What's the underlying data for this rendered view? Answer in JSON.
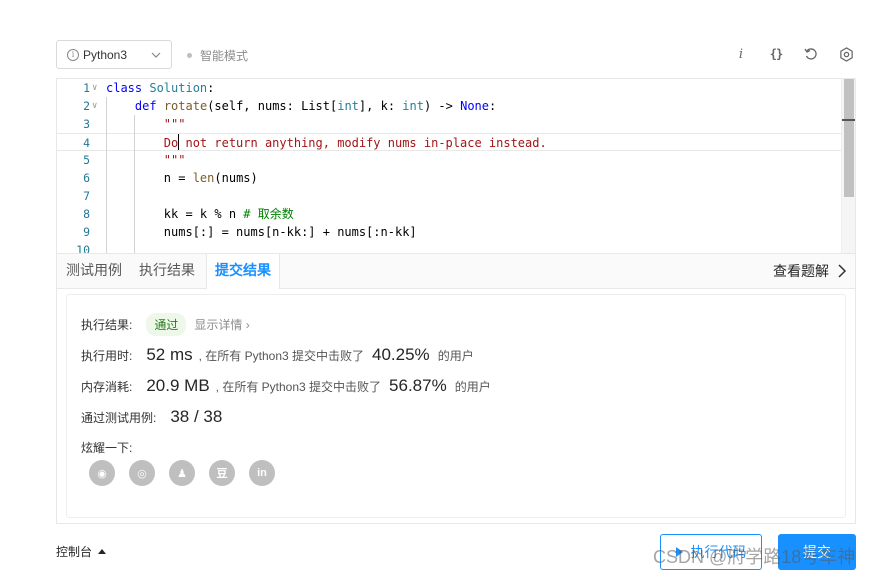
{
  "toolbar": {
    "language": "Python3",
    "smart_mode": "智能模式",
    "icons": [
      "info-icon",
      "braces-icon",
      "reset-icon",
      "settings-icon"
    ]
  },
  "editor": {
    "lines": [
      {
        "n": "1",
        "fold": "∨",
        "tokens": [
          [
            "kw",
            "class"
          ],
          [
            "",
            " "
          ],
          [
            "cls",
            "Solution"
          ],
          [
            "",
            ":"
          ]
        ]
      },
      {
        "n": "2",
        "fold": "∨",
        "tokens": [
          [
            "",
            "    "
          ],
          [
            "kw",
            "def"
          ],
          [
            "",
            " "
          ],
          [
            "fn",
            "rotate"
          ],
          [
            "",
            "(self, nums: List["
          ],
          [
            "bi",
            "int"
          ],
          [
            "",
            "], k: "
          ],
          [
            "bi",
            "int"
          ],
          [
            "",
            ") -> "
          ],
          [
            "kw",
            "None"
          ],
          [
            "",
            ":"
          ]
        ]
      },
      {
        "n": "3",
        "fold": "",
        "tokens": [
          [
            "",
            "        "
          ],
          [
            "str",
            "\"\"\""
          ]
        ]
      },
      {
        "n": "4",
        "fold": "",
        "tokens": [
          [
            "",
            "        "
          ],
          [
            "str",
            "Do not return anything, modify nums in-place instead."
          ]
        ]
      },
      {
        "n": "5",
        "fold": "",
        "tokens": [
          [
            "",
            "        "
          ],
          [
            "str",
            "\"\"\""
          ]
        ]
      },
      {
        "n": "6",
        "fold": "",
        "tokens": [
          [
            "",
            "        n = "
          ],
          [
            "fn",
            "len"
          ],
          [
            "",
            "(nums)"
          ]
        ]
      },
      {
        "n": "7",
        "fold": "",
        "tokens": [
          [
            "",
            ""
          ]
        ]
      },
      {
        "n": "8",
        "fold": "",
        "tokens": [
          [
            "",
            "        kk = k % n "
          ],
          [
            "cm",
            "# 取余数"
          ]
        ]
      },
      {
        "n": "9",
        "fold": "",
        "tokens": [
          [
            "",
            "        nums[:] = nums[n-kk:] + nums[:n-kk]"
          ]
        ]
      },
      {
        "n": "10",
        "fold": "",
        "tokens": [
          [
            "",
            ""
          ]
        ]
      }
    ]
  },
  "tabs": {
    "test_cases": "测试用例",
    "run_result": "执行结果",
    "submit_result": "提交结果",
    "view_solution": "查看题解"
  },
  "result": {
    "status_label": "执行结果:",
    "status_value": "通过",
    "details_link": "显示详情 ›",
    "time_label": "执行用时:",
    "time_value": "52 ms",
    "time_mid": ", 在所有 Python3 提交中击败了",
    "time_pct": "40.25%",
    "time_suffix": "的用户",
    "mem_label": "内存消耗:",
    "mem_value": "20.9 MB",
    "mem_mid": ", 在所有 Python3 提交中击败了",
    "mem_pct": "56.87%",
    "mem_suffix": "的用户",
    "cases_label": "通过测试用例:",
    "cases_value": "38 / 38",
    "share_label": "炫耀一下:",
    "share_icons": [
      {
        "name": "wechat-icon",
        "glyph": "◉"
      },
      {
        "name": "weibo-icon",
        "glyph": "◎"
      },
      {
        "name": "qq-icon",
        "glyph": "♟"
      },
      {
        "name": "douban-icon",
        "glyph": "豆"
      },
      {
        "name": "linkedin-icon",
        "glyph": "in"
      }
    ]
  },
  "footer": {
    "console": "控制台",
    "run_code": "执行代码",
    "submit": "提交",
    "watermark": "CSDN @府学路18号车神"
  },
  "colors": {
    "accent": "#1890ff",
    "pass_bg": "#edf8e9",
    "pass_text": "#2b7a1e"
  }
}
